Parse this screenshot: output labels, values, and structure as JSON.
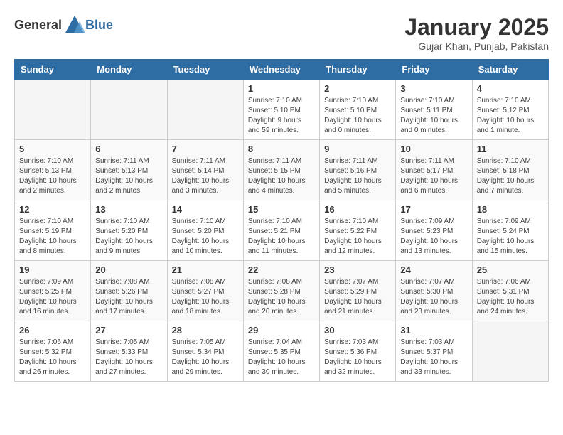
{
  "header": {
    "logo_general": "General",
    "logo_blue": "Blue",
    "month_year": "January 2025",
    "location": "Gujar Khan, Punjab, Pakistan"
  },
  "weekdays": [
    "Sunday",
    "Monday",
    "Tuesday",
    "Wednesday",
    "Thursday",
    "Friday",
    "Saturday"
  ],
  "weeks": [
    [
      {
        "day": "",
        "info": ""
      },
      {
        "day": "",
        "info": ""
      },
      {
        "day": "",
        "info": ""
      },
      {
        "day": "1",
        "info": "Sunrise: 7:10 AM\nSunset: 5:10 PM\nDaylight: 9 hours\nand 59 minutes."
      },
      {
        "day": "2",
        "info": "Sunrise: 7:10 AM\nSunset: 5:10 PM\nDaylight: 10 hours\nand 0 minutes."
      },
      {
        "day": "3",
        "info": "Sunrise: 7:10 AM\nSunset: 5:11 PM\nDaylight: 10 hours\nand 0 minutes."
      },
      {
        "day": "4",
        "info": "Sunrise: 7:10 AM\nSunset: 5:12 PM\nDaylight: 10 hours\nand 1 minute."
      }
    ],
    [
      {
        "day": "5",
        "info": "Sunrise: 7:10 AM\nSunset: 5:13 PM\nDaylight: 10 hours\nand 2 minutes."
      },
      {
        "day": "6",
        "info": "Sunrise: 7:11 AM\nSunset: 5:13 PM\nDaylight: 10 hours\nand 2 minutes."
      },
      {
        "day": "7",
        "info": "Sunrise: 7:11 AM\nSunset: 5:14 PM\nDaylight: 10 hours\nand 3 minutes."
      },
      {
        "day": "8",
        "info": "Sunrise: 7:11 AM\nSunset: 5:15 PM\nDaylight: 10 hours\nand 4 minutes."
      },
      {
        "day": "9",
        "info": "Sunrise: 7:11 AM\nSunset: 5:16 PM\nDaylight: 10 hours\nand 5 minutes."
      },
      {
        "day": "10",
        "info": "Sunrise: 7:11 AM\nSunset: 5:17 PM\nDaylight: 10 hours\nand 6 minutes."
      },
      {
        "day": "11",
        "info": "Sunrise: 7:10 AM\nSunset: 5:18 PM\nDaylight: 10 hours\nand 7 minutes."
      }
    ],
    [
      {
        "day": "12",
        "info": "Sunrise: 7:10 AM\nSunset: 5:19 PM\nDaylight: 10 hours\nand 8 minutes."
      },
      {
        "day": "13",
        "info": "Sunrise: 7:10 AM\nSunset: 5:20 PM\nDaylight: 10 hours\nand 9 minutes."
      },
      {
        "day": "14",
        "info": "Sunrise: 7:10 AM\nSunset: 5:20 PM\nDaylight: 10 hours\nand 10 minutes."
      },
      {
        "day": "15",
        "info": "Sunrise: 7:10 AM\nSunset: 5:21 PM\nDaylight: 10 hours\nand 11 minutes."
      },
      {
        "day": "16",
        "info": "Sunrise: 7:10 AM\nSunset: 5:22 PM\nDaylight: 10 hours\nand 12 minutes."
      },
      {
        "day": "17",
        "info": "Sunrise: 7:09 AM\nSunset: 5:23 PM\nDaylight: 10 hours\nand 13 minutes."
      },
      {
        "day": "18",
        "info": "Sunrise: 7:09 AM\nSunset: 5:24 PM\nDaylight: 10 hours\nand 15 minutes."
      }
    ],
    [
      {
        "day": "19",
        "info": "Sunrise: 7:09 AM\nSunset: 5:25 PM\nDaylight: 10 hours\nand 16 minutes."
      },
      {
        "day": "20",
        "info": "Sunrise: 7:08 AM\nSunset: 5:26 PM\nDaylight: 10 hours\nand 17 minutes."
      },
      {
        "day": "21",
        "info": "Sunrise: 7:08 AM\nSunset: 5:27 PM\nDaylight: 10 hours\nand 18 minutes."
      },
      {
        "day": "22",
        "info": "Sunrise: 7:08 AM\nSunset: 5:28 PM\nDaylight: 10 hours\nand 20 minutes."
      },
      {
        "day": "23",
        "info": "Sunrise: 7:07 AM\nSunset: 5:29 PM\nDaylight: 10 hours\nand 21 minutes."
      },
      {
        "day": "24",
        "info": "Sunrise: 7:07 AM\nSunset: 5:30 PM\nDaylight: 10 hours\nand 23 minutes."
      },
      {
        "day": "25",
        "info": "Sunrise: 7:06 AM\nSunset: 5:31 PM\nDaylight: 10 hours\nand 24 minutes."
      }
    ],
    [
      {
        "day": "26",
        "info": "Sunrise: 7:06 AM\nSunset: 5:32 PM\nDaylight: 10 hours\nand 26 minutes."
      },
      {
        "day": "27",
        "info": "Sunrise: 7:05 AM\nSunset: 5:33 PM\nDaylight: 10 hours\nand 27 minutes."
      },
      {
        "day": "28",
        "info": "Sunrise: 7:05 AM\nSunset: 5:34 PM\nDaylight: 10 hours\nand 29 minutes."
      },
      {
        "day": "29",
        "info": "Sunrise: 7:04 AM\nSunset: 5:35 PM\nDaylight: 10 hours\nand 30 minutes."
      },
      {
        "day": "30",
        "info": "Sunrise: 7:03 AM\nSunset: 5:36 PM\nDaylight: 10 hours\nand 32 minutes."
      },
      {
        "day": "31",
        "info": "Sunrise: 7:03 AM\nSunset: 5:37 PM\nDaylight: 10 hours\nand 33 minutes."
      },
      {
        "day": "",
        "info": ""
      }
    ]
  ]
}
